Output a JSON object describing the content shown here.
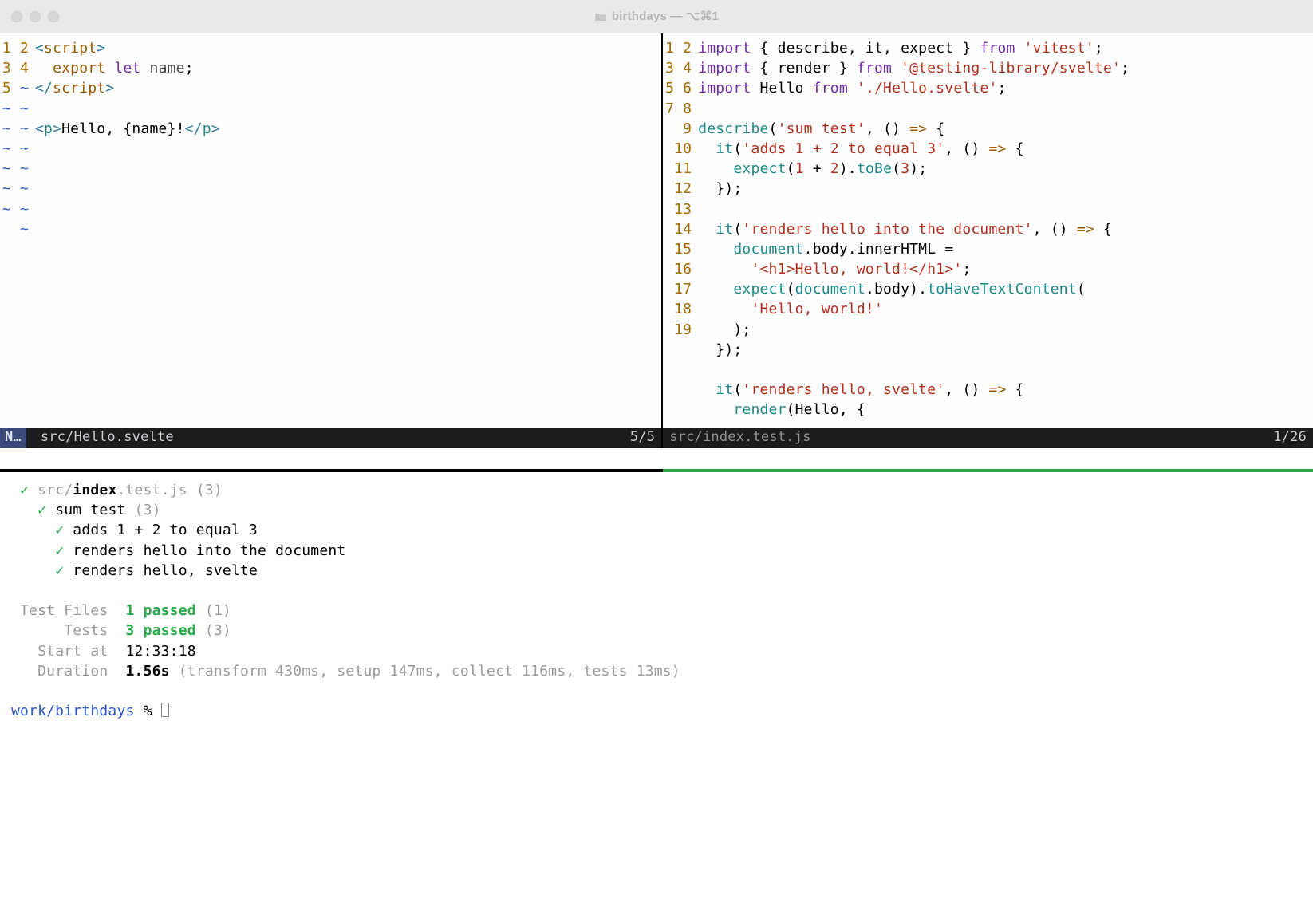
{
  "window": {
    "title": "birthdays — ⌥⌘1"
  },
  "left_pane": {
    "file": "src/Hello.svelte",
    "mode": "N…",
    "position": "5/5",
    "total_rows": 19,
    "lines": [
      {
        "n": 1,
        "html": "<span class='c-tag'>&lt;</span><span class='c-kw2'>script</span><span class='c-tag'>&gt;</span>"
      },
      {
        "n": 2,
        "html": "  <span class='c-kw2'>export</span> <span class='c-kw'>let</span> <span class='c-name'>name</span>;"
      },
      {
        "n": 3,
        "html": "<span class='c-tag'>&lt;/</span><span class='c-kw2'>script</span><span class='c-tag'>&gt;</span>"
      },
      {
        "n": 4,
        "html": ""
      },
      {
        "n": 5,
        "html": "<span class='c-tag'>&lt;</span><span class='c-fn'>p</span><span class='c-tag'>&gt;</span>Hello, {name}!<span class='c-tag'>&lt;/</span><span class='c-fn'>p</span><span class='c-tag'>&gt;</span>"
      }
    ]
  },
  "right_pane": {
    "file": "src/index.test.js",
    "position": "1/26",
    "total_rows": 19,
    "lines": [
      {
        "n": 1,
        "html": "<span class='c-kw'>import</span> { describe, it, expect } <span class='c-kw'>from</span> <span class='c-str'>'vitest'</span>;"
      },
      {
        "n": 2,
        "html": "<span class='c-kw'>import</span> { render } <span class='c-kw'>from</span> <span class='c-str'>'@testing-library/svelte'</span>;"
      },
      {
        "n": 3,
        "html": "<span class='c-kw'>import</span> Hello <span class='c-kw'>from</span> <span class='c-str'>'./Hello.svelte'</span>;"
      },
      {
        "n": 4,
        "html": ""
      },
      {
        "n": 5,
        "html": "<span class='c-fn'>describe</span>(<span class='c-str'>'sum test'</span>, () <span class='c-kw2'>=&gt;</span> {"
      },
      {
        "n": 6,
        "html": "  <span class='c-fn'>it</span>(<span class='c-str'>'adds 1 + 2 to equal 3'</span>, () <span class='c-kw2'>=&gt;</span> {"
      },
      {
        "n": 7,
        "html": "    <span class='c-fn'>expect</span>(<span class='c-num'>1</span> + <span class='c-num'>2</span>).<span class='c-fn'>toBe</span>(<span class='c-num'>3</span>);"
      },
      {
        "n": 8,
        "html": "  });"
      },
      {
        "n": 9,
        "html": ""
      },
      {
        "n": 10,
        "html": "  <span class='c-fn'>it</span>(<span class='c-str'>'renders hello into the document'</span>, () <span class='c-kw2'>=&gt;</span> {"
      },
      {
        "n": 11,
        "html": "    <span class='c-fn'>document</span>.body.innerHTML ="
      },
      {
        "n": 12,
        "html": "      <span class='c-str'>'&lt;h1&gt;Hello, world!&lt;/h1&gt;'</span>;"
      },
      {
        "n": 13,
        "html": "    <span class='c-fn'>expect</span>(<span class='c-fn'>document</span>.body).<span class='c-fn'>toHaveTextContent</span>("
      },
      {
        "n": 14,
        "html": "      <span class='c-str'>'Hello, world!'</span>"
      },
      {
        "n": 15,
        "html": "    );"
      },
      {
        "n": 16,
        "html": "  });"
      },
      {
        "n": 17,
        "html": ""
      },
      {
        "n": 18,
        "html": "  <span class='c-fn'>it</span>(<span class='c-str'>'renders hello, svelte'</span>, () <span class='c-kw2'>=&gt;</span> {"
      },
      {
        "n": 19,
        "html": "    <span class='c-fn'>render</span>(Hello, {"
      }
    ]
  },
  "terminal": {
    "file_line_prefix": "src/",
    "file_line_bold": "index",
    "file_line_suffix": ".test.js (3)",
    "suite": {
      "name": "sum test",
      "count": "(3)"
    },
    "tests": [
      "adds 1 + 2 to equal 3",
      "renders hello into the document",
      "renders hello, svelte"
    ],
    "summary": {
      "test_files_label": "Test Files",
      "test_files_value": "1 passed",
      "test_files_paren": "(1)",
      "tests_label": "Tests",
      "tests_value": "3 passed",
      "tests_paren": "(3)",
      "start_label": "Start at",
      "start_value": "12:33:18",
      "duration_label": "Duration",
      "duration_value": "1.56s",
      "duration_detail": "(transform 430ms, setup 147ms, collect 116ms, tests 13ms)"
    },
    "prompt_path": "work/birthdays",
    "prompt_symbol": "%"
  }
}
